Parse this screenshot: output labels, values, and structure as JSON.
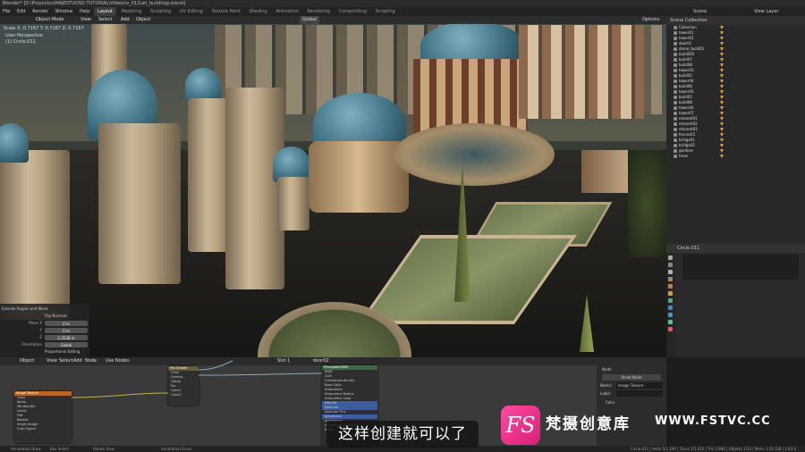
{
  "window": {
    "title": "Blender* [D:\\Proyectos\\MAJESTUOSO TUTORIAL\\Videos\\v_012\\alt_buildings.blend]"
  },
  "menu": {
    "items": [
      "File",
      "Edit",
      "Render",
      "Window",
      "Help"
    ],
    "workspaces": [
      "Layout",
      "Modeling",
      "Sculpting",
      "UV Editing",
      "Texture Paint",
      "Shading",
      "Animation",
      "Rendering",
      "Compositing",
      "Scripting"
    ],
    "active_workspace": "Layout",
    "scene": "Scene",
    "view_layer": "View Layer"
  },
  "viewport": {
    "mode": "Object Mode",
    "view": "View",
    "select": "Select",
    "add": "Add",
    "object": "Object",
    "transform": "Global",
    "overlay_text_1": "User Perspective",
    "overlay_text_2": "(1) Circle.011",
    "status_line": "Scale X: 0.7167  Y: 0.7167  Z: 0.7167",
    "options": "Options"
  },
  "operator_panel": {
    "title": "Extrude Region and Move",
    "flip_normals": "Flip Normals",
    "move_x_label": "Move X",
    "move_x": "0 m",
    "move_y_label": "Y",
    "move_y": "0 m",
    "move_z_label": "Z",
    "move_z": "2.3538 m",
    "orientation_label": "Orientation",
    "orientation": "Global",
    "proportional": "Proportional Editing"
  },
  "outliner": {
    "header": "Scene Collection",
    "items": [
      "Collection",
      "tower01",
      "tower02",
      "door01",
      "dome_build01",
      "build005",
      "build07",
      "build08",
      "tower03",
      "build02",
      "tower04",
      "build06",
      "tower05",
      "build05",
      "build08",
      "tower06",
      "tower07",
      "minaret01",
      "minaret02",
      "minaret03",
      "fences01",
      "bridge01",
      "bridge02",
      "gardens",
      "trees"
    ]
  },
  "properties": {
    "object_name": "Circle.011"
  },
  "node_editor": {
    "toolbar": [
      "Object",
      "View",
      "Select",
      "Add",
      "Node",
      "Use Nodes"
    ],
    "slot": "Slot 1",
    "material": "door02",
    "nodes": {
      "image_texture": {
        "title": "Image Texture",
        "rows": [
          "Color",
          "Alpha",
          "Window.Dis",
          "Linear",
          "Flat",
          "Repeat",
          "Single Image",
          "Color Space"
        ]
      },
      "mix": {
        "title": "Mix Shader",
        "rows": [
          "Color",
          "Overlay",
          "Clamp",
          "Fac",
          "Color1",
          "Color2"
        ]
      },
      "bsdf": {
        "title": "Principled BSDF",
        "rows": [
          "BSDF",
          "GGX",
          "Christensen-Burley",
          "Base Color",
          "Subsurface",
          "Subsurface Radius",
          "Subsurface Color",
          "Metallic",
          "Specular",
          "Specular Tint",
          "Roughness",
          "Anisotropic",
          "Anisotropic Rotation",
          "Sheen"
        ]
      }
    },
    "n_panel": {
      "title": "Node",
      "label_name": "Name:",
      "name": "Image Texture",
      "label_label": "Label:",
      "reset": "Reset Node",
      "color": "Color"
    }
  },
  "statusbar": {
    "left": "Annotation Draw",
    "mid1": "Box Select",
    "mid2": "Rotate View",
    "mid3": "Annotation Erase",
    "right": "Circle.011 | Verts 5/1,206 | Faces 2/1,016 | Tris 2,986 | Objects 1/33 | Mem: 1.91 GiB | 2.83.0"
  },
  "subtitle": "这样创建就可以了",
  "watermark": {
    "logo": "FS",
    "cn": "梵摄创意库",
    "url": "WWW.FSTVC.CC"
  }
}
